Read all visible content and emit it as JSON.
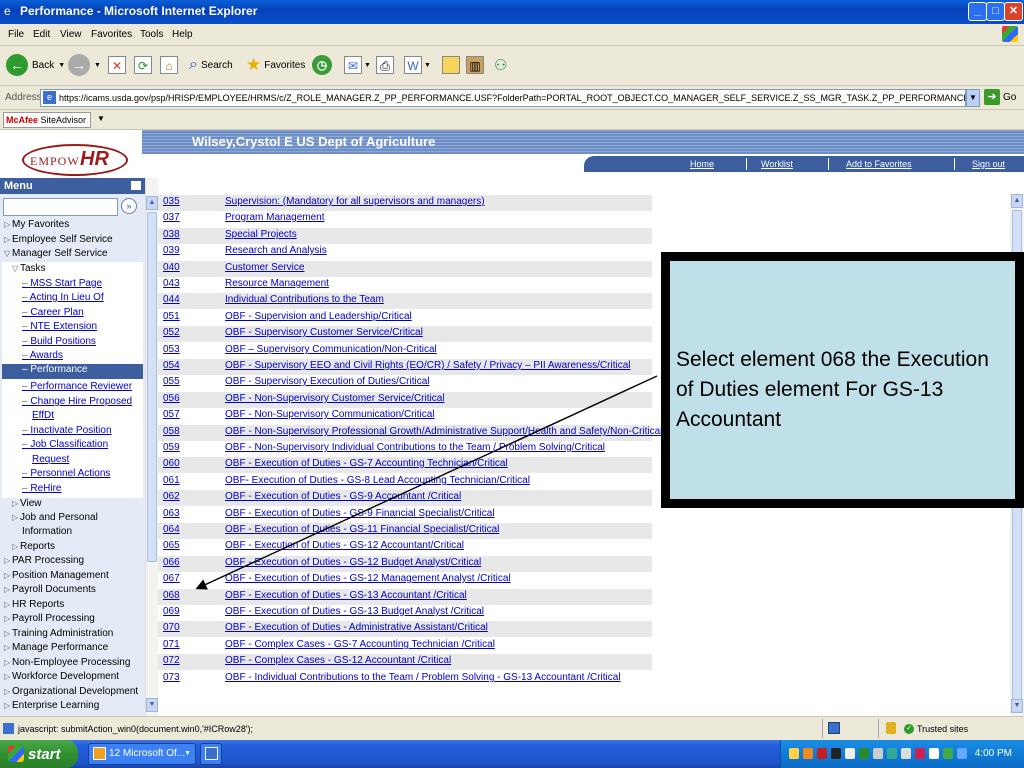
{
  "window": {
    "title": "Performance - Microsoft Internet Explorer"
  },
  "menu": [
    "File",
    "Edit",
    "View",
    "Favorites",
    "Tools",
    "Help"
  ],
  "toolbar": {
    "back": "Back",
    "search": "Search",
    "favorites": "Favorites"
  },
  "address": {
    "label": "Address",
    "url": "https://icams.usda.gov/psp/HRISP/EMPLOYEE/HRMS/c/Z_ROLE_MANAGER.Z_PP_PERFORMANCE.USF?FolderPath=PORTAL_ROOT_OBJECT.CO_MANAGER_SELF_SERVICE.Z_SS_MGR_TASK.Z_PP_PERFORMANCE_USF_1&IsFolder=false",
    "go": "Go"
  },
  "mcafee": {
    "brand": "McAfee",
    "label": "SiteAdvisor"
  },
  "header": {
    "user": "Wilsey,Crystol E  US Dept of Agriculture",
    "logo_text": "EMPOW",
    "logo_hr": "HR",
    "nav": [
      "Home",
      "Worklist",
      "Add to Favorites",
      "Sign out"
    ]
  },
  "leftmenu": {
    "title": "Menu",
    "search_btn": "»",
    "top_items": [
      "My Favorites",
      "Employee Self Service",
      "Manager Self Service"
    ],
    "tasks_label": "Tasks",
    "tasks": [
      "MSS Start Page",
      "Acting In Lieu Of",
      "Career Plan",
      "NTE Extension",
      "Build Positions",
      "Awards",
      "Performance",
      "Performance Reviewer",
      "Change Hire Proposed",
      "EffDt",
      "Inactivate Position",
      "Job Classification",
      "Request",
      "Personnel Actions",
      "ReHire"
    ],
    "after_tasks": [
      "View",
      "Job and Personal",
      "Information",
      "Reports"
    ],
    "bottom_items": [
      "PAR Processing",
      "Position Management",
      "Payroll Documents",
      "HR Reports",
      "Payroll Processing",
      "Training Administration",
      "Manage Performance",
      "Non-Employee Processing",
      "Workforce Development",
      "Organizational Development",
      "Enterprise Learning"
    ]
  },
  "elements": [
    {
      "code": "035",
      "desc": "Supervision: (Mandatory for all supervisors and managers)"
    },
    {
      "code": "037",
      "desc": "Program Management"
    },
    {
      "code": "038",
      "desc": "Special Projects"
    },
    {
      "code": "039",
      "desc": "Research and Analysis"
    },
    {
      "code": "040",
      "desc": "Customer Service"
    },
    {
      "code": "043",
      "desc": "Resource Management"
    },
    {
      "code": "044",
      "desc": "Individual Contributions to the Team"
    },
    {
      "code": "051",
      "desc": "OBF - Supervision and Leadership/Critical"
    },
    {
      "code": "052",
      "desc": "OBF - Supervisory Customer Service/Critical"
    },
    {
      "code": "053",
      "desc": "OBF – Supervisory Communication/Non-Critical"
    },
    {
      "code": "054",
      "desc": "OBF - Supervisory EEO and Civil Rights (EO/CR) / Safety / Privacy – PII Awareness/Critical"
    },
    {
      "code": "055",
      "desc": "OBF - Supervisory Execution of Duties/Critical"
    },
    {
      "code": "056",
      "desc": "OBF - Non-Supervisory Customer Service/Critical"
    },
    {
      "code": "057",
      "desc": "OBF - Non-Supervisory Communication/Critical"
    },
    {
      "code": "058",
      "desc": "OBF - Non-Supervisory Professional Growth/Administrative Support/Health and Safety/Non-Critical"
    },
    {
      "code": "059",
      "desc": "OBF - Non-Supervisory Individual Contributions to the Team / Problem Solving/Critical"
    },
    {
      "code": "060",
      "desc": "OBF - Execution of Duties - GS-7 Accounting Technician/Critical"
    },
    {
      "code": "061",
      "desc": "OBF- Execution of Duties - GS-8 Lead Accounting Technician/Critical"
    },
    {
      "code": "062",
      "desc": "OBF - Execution of Duties - GS-9 Accountant /Critical"
    },
    {
      "code": "063",
      "desc": "OBF - Execution of Duties - GS-9 Financial Specialist/Critical"
    },
    {
      "code": "064",
      "desc": "OBF - Execution of Duties - GS-11 Financial Specialist/Critical"
    },
    {
      "code": "065",
      "desc": "OBF - Execution of Duties - GS-12 Accountant/Critical"
    },
    {
      "code": "066",
      "desc": "OBF - Execution of Duties - GS-12 Budget Analyst/Critical"
    },
    {
      "code": "067",
      "desc": "OBF - Execution of Duties - GS-12 Management Analyst /Critical"
    },
    {
      "code": "068",
      "desc": "OBF - Execution of Duties - GS-13 Accountant /Critical"
    },
    {
      "code": "069",
      "desc": "OBF - Execution of Duties - GS-13 Budget Analyst /Critical"
    },
    {
      "code": "070",
      "desc": "OBF - Execution of Duties - Administrative Assistant/Critical"
    },
    {
      "code": "071",
      "desc": "OBF - Complex Cases - GS-7 Accounting Technician /Critical"
    },
    {
      "code": "072",
      "desc": "OBF - Complex Cases - GS-12 Accountant /Critical"
    },
    {
      "code": "073",
      "desc": "OBF - Individual Contributions to the Team / Problem Solving - GS-13 Accountant /Critical"
    }
  ],
  "callout": {
    "text": "Select element 068 the Execution of Duties element For GS-13 Accountant"
  },
  "status": {
    "text": "javascript: submitAction_win0(document.win0,'#ICRow28');",
    "zone": "Trusted sites"
  },
  "taskbar": {
    "start": "start",
    "task1": "12 Microsoft Of...",
    "clock": "4:00 PM"
  }
}
